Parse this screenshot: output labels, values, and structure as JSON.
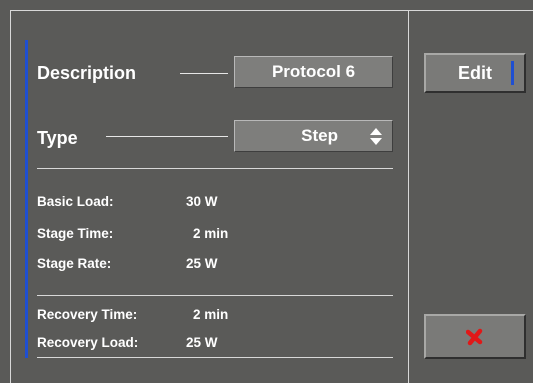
{
  "description": {
    "label": "Description",
    "value": "Protocol 6"
  },
  "type": {
    "label": "Type",
    "value": "Step"
  },
  "parameters": [
    {
      "label": "Basic Load:",
      "value": "30 W"
    },
    {
      "label": "Stage Time:",
      "value": "2 min"
    },
    {
      "label": "Stage Rate:",
      "value": "25 W"
    }
  ],
  "recovery": [
    {
      "label": "Recovery Time:",
      "value": "2 min"
    },
    {
      "label": "Recovery Load:",
      "value": "25 W"
    }
  ],
  "buttons": {
    "edit_label": "Edit",
    "cancel_icon": "close-icon"
  },
  "colors": {
    "background": "#5a5a58",
    "accent": "#1f4fd1",
    "cancel": "#e01818"
  }
}
